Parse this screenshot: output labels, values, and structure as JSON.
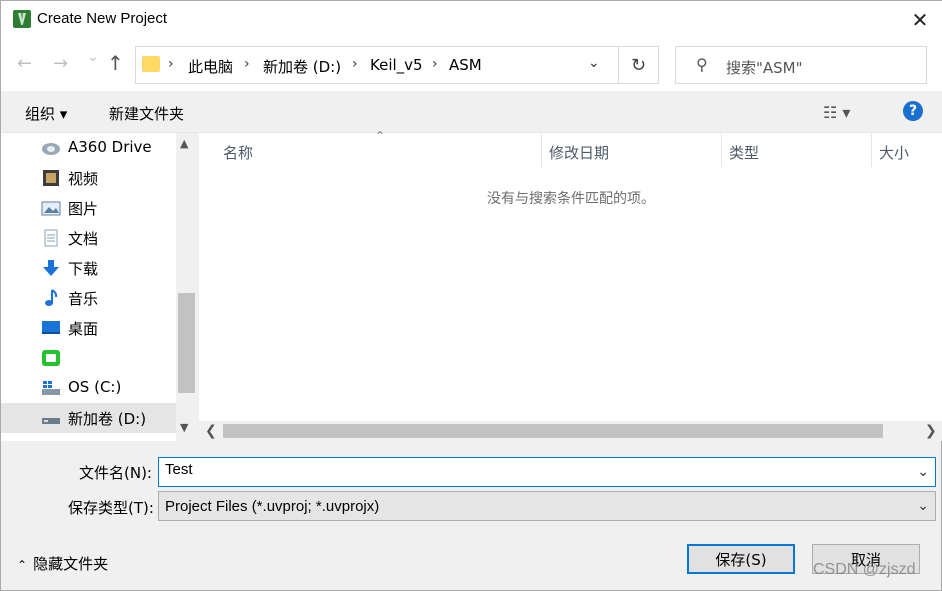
{
  "window": {
    "title": "Create New Project",
    "close_glyph": "✕"
  },
  "nav": {
    "back_glyph": "←",
    "forward_glyph": "→",
    "recent_glyph": "⌄",
    "up_glyph": "↑",
    "breadcrumbs": [
      "此电脑",
      "新加卷 (D:)",
      "Keil_v5",
      "ASM"
    ],
    "crumb_sep": "›",
    "dropdown_glyph": "⌄",
    "refresh_glyph": "↻",
    "search_placeholder": "搜索\"ASM\"",
    "search_glyph": "⚲"
  },
  "toolbar": {
    "organize": "组织 ▾",
    "new_folder": "新建文件夹",
    "view_glyph": "☷ ▾",
    "help_glyph": "?"
  },
  "sidebar": {
    "items": [
      {
        "label": "A360 Drive",
        "icon": "a360-drive-icon",
        "color": "#7c8a99"
      },
      {
        "label": "视频",
        "icon": "video-icon",
        "color": "#4a4a4a"
      },
      {
        "label": "图片",
        "icon": "pictures-icon",
        "color": "#5b7fa6"
      },
      {
        "label": "文档",
        "icon": "documents-icon",
        "color": "#8aa0b8"
      },
      {
        "label": "下载",
        "icon": "download-icon",
        "color": "#1a73d9"
      },
      {
        "label": "音乐",
        "icon": "music-icon",
        "color": "#1a73d9"
      },
      {
        "label": "桌面",
        "icon": "desktop-icon",
        "color": "#1a73d9"
      },
      {
        "label": "",
        "icon": "app-drive-icon",
        "color": "#22c32e"
      },
      {
        "label": "OS (C:)",
        "icon": "os-drive-icon",
        "color": "#5a6b7c"
      },
      {
        "label": "新加卷 (D:)",
        "icon": "hard-drive-icon",
        "color": "#5a6b7c"
      }
    ]
  },
  "filelist": {
    "columns": [
      "名称",
      "修改日期",
      "类型",
      "大小"
    ],
    "empty_message": "没有与搜索条件匹配的项。"
  },
  "form": {
    "filename_label": "文件名(N):",
    "filename_value": "Test",
    "filetype_label": "保存类型(T):",
    "filetype_value": "Project Files (*.uvproj; *.uvprojx)",
    "chevron_glyph": "⌄"
  },
  "footer": {
    "hide_folders": "隐藏文件夹",
    "save": "保存(S)",
    "cancel": "取消",
    "watermark": "CSDN @zjszd"
  }
}
